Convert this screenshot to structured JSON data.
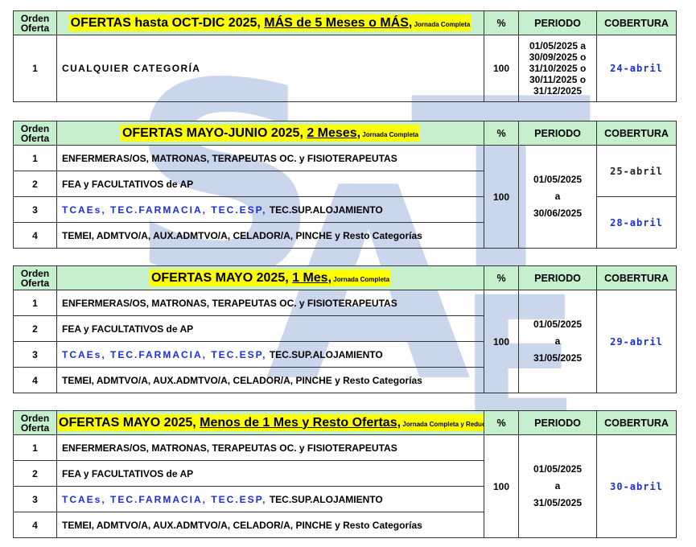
{
  "headers": {
    "orden_line1": "Orden",
    "orden_line2": "Oferta",
    "pct": "%",
    "periodo": "PERIODO",
    "cobertura": "COBERTURA"
  },
  "watermark": [
    "S",
    "A",
    "T",
    "E"
  ],
  "tables": [
    {
      "title_plain": "OFERTAS hasta OCT-DIC 2025, ",
      "title_underlined": "MÁS de 5 Meses o MÁS,",
      "title_small": " Jornada Completa",
      "pct": "100",
      "rows": [
        {
          "n": "1",
          "cat": "CUALQUIER CATEGORÍA"
        }
      ],
      "periodo": [
        "01/05/2025 a",
        "30/09/2025 o",
        "31/10/2025 o",
        "30/11/2025 o",
        "31/12/2025"
      ],
      "cobertura": [
        "24-abril"
      ]
    },
    {
      "title_plain": "OFERTAS MAYO-JUNIO 2025, ",
      "title_underlined": "2 Meses,",
      "title_small": " Jornada Completa",
      "pct": "100",
      "rows": [
        {
          "n": "1",
          "cat": "ENFERMERAS/OS, MATRONAS, TERAPEUTAS OC. y FISIOTERAPEUTAS"
        },
        {
          "n": "2",
          "cat": "FEA y FACULTATIVOS de AP"
        },
        {
          "n": "3",
          "cat_blue": "TCAEs, TEC.FARMACIA, TEC.ESP,",
          "cat": " TEC.SUP.ALOJAMIENTO"
        },
        {
          "n": "4",
          "cat": "TEMEI, ADMTVO/A, AUX.ADMTVO/A, CELADOR/A, PINCHE y Resto Categorías"
        }
      ],
      "periodo": [
        "01/05/2025",
        "a",
        "30/06/2025"
      ],
      "cobertura": [
        "25-abril",
        "28-abril"
      ]
    },
    {
      "title_plain": "OFERTAS MAYO 2025, ",
      "title_underlined": "1 Mes,",
      "title_small": " Jornada Completa",
      "pct": "100",
      "rows": [
        {
          "n": "1",
          "cat": "ENFERMERAS/OS, MATRONAS, TERAPEUTAS OC. y FISIOTERAPEUTAS"
        },
        {
          "n": "2",
          "cat": "FEA y FACULTATIVOS de AP"
        },
        {
          "n": "3",
          "cat_blue": "TCAEs, TEC.FARMACIA, TEC.ESP,",
          "cat": " TEC.SUP.ALOJAMIENTO"
        },
        {
          "n": "4",
          "cat": "TEMEI, ADMTVO/A, AUX.ADMTVO/A, CELADOR/A, PINCHE y Resto Categorías"
        }
      ],
      "periodo": [
        "01/05/2025",
        "a",
        "31/05/2025"
      ],
      "cobertura": [
        "29-abril"
      ]
    },
    {
      "title_plain": "OFERTAS MAYO 2025, ",
      "title_underlined": "Menos de 1 Mes y Resto Ofertas,",
      "title_small": " Jornada Completa y Reducida",
      "pct": "100",
      "rows": [
        {
          "n": "1",
          "cat": "ENFERMERAS/OS, MATRONAS, TERAPEUTAS OC. y FISIOTERAPEUTAS"
        },
        {
          "n": "2",
          "cat": "FEA y FACULTATIVOS de AP"
        },
        {
          "n": "3",
          "cat_blue": "TCAEs, TEC.FARMACIA, TEC.ESP,",
          "cat": " TEC.SUP.ALOJAMIENTO"
        },
        {
          "n": "4",
          "cat": "TEMEI, ADMTVO/A, AUX.ADMTVO/A, CELADOR/A, PINCHE y Resto Categorías"
        }
      ],
      "periodo": [
        "01/05/2025",
        "a",
        "31/05/2025"
      ],
      "cobertura": [
        "30-abril"
      ]
    }
  ]
}
